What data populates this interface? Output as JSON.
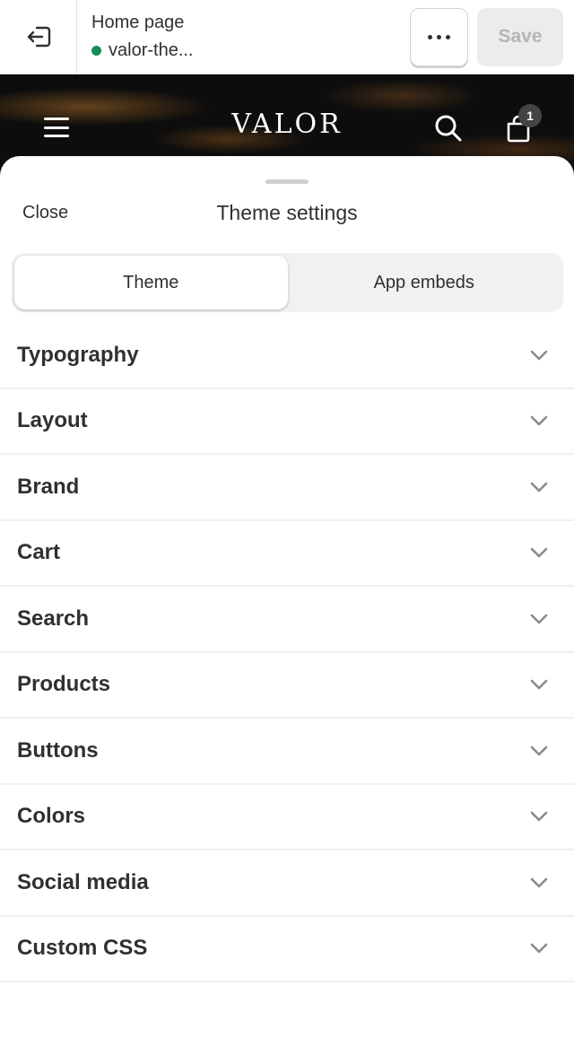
{
  "topbar": {
    "page_title": "Home page",
    "theme_name": "valor-the...",
    "save_label": "Save",
    "status_color": "#1a8a5a"
  },
  "preview": {
    "brand": "VALOR",
    "cart_count": "1"
  },
  "sheet": {
    "close_label": "Close",
    "title": "Theme settings",
    "tabs": [
      {
        "label": "Theme",
        "active": true
      },
      {
        "label": "App embeds",
        "active": false
      }
    ],
    "sections": [
      {
        "label": "Typography"
      },
      {
        "label": "Layout"
      },
      {
        "label": "Brand"
      },
      {
        "label": "Cart"
      },
      {
        "label": "Search"
      },
      {
        "label": "Products"
      },
      {
        "label": "Buttons"
      },
      {
        "label": "Colors"
      },
      {
        "label": "Social media"
      },
      {
        "label": "Custom CSS"
      }
    ]
  }
}
